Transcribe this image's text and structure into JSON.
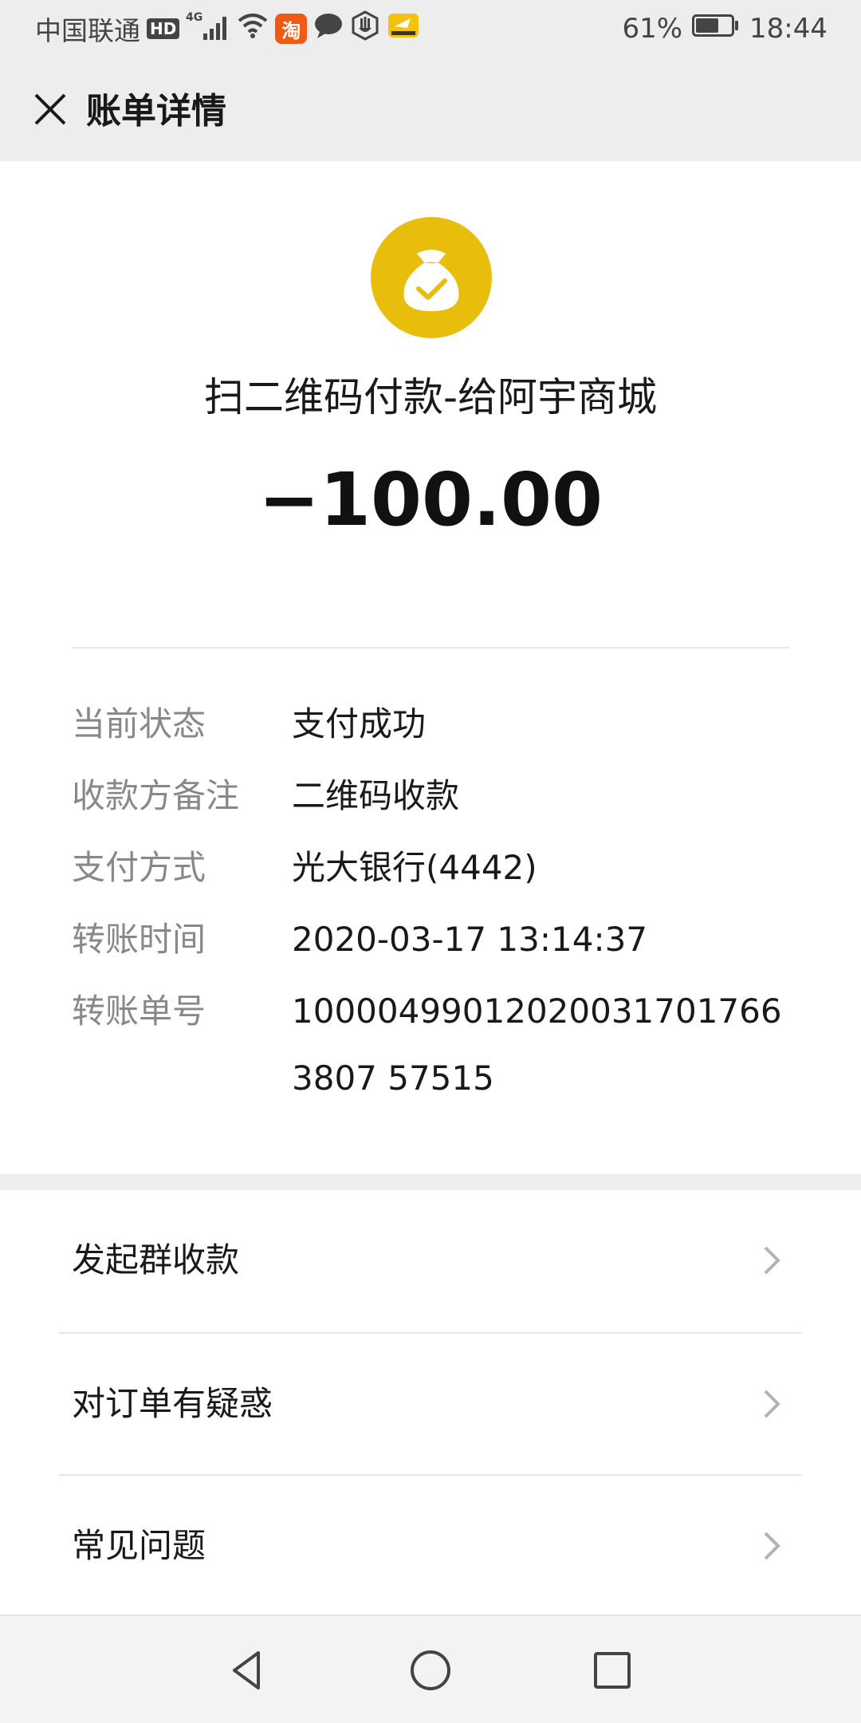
{
  "status_bar": {
    "carrier": "中国联通",
    "hd": "HD",
    "network": "4G",
    "taobao_badge": "淘",
    "battery": "61%",
    "time": "18:44"
  },
  "header": {
    "title": "账单详情"
  },
  "transaction": {
    "merchant": "扫二维码付款-给阿宇商城",
    "amount": "−100.00",
    "accent_color": "#e8bd0c"
  },
  "details": [
    {
      "label": "当前状态",
      "value": "支付成功"
    },
    {
      "label": "收款方备注",
      "value": "二维码收款"
    },
    {
      "label": "支付方式",
      "value": "光大银行(4442)"
    },
    {
      "label": "转账时间",
      "value": "2020-03-17 13:14:37"
    },
    {
      "label": "转账单号",
      "value": "100004990120200317017663807 57515"
    }
  ],
  "actions": [
    {
      "label": "发起群收款"
    },
    {
      "label": "对订单有疑惑"
    },
    {
      "label": "常见问题"
    }
  ]
}
